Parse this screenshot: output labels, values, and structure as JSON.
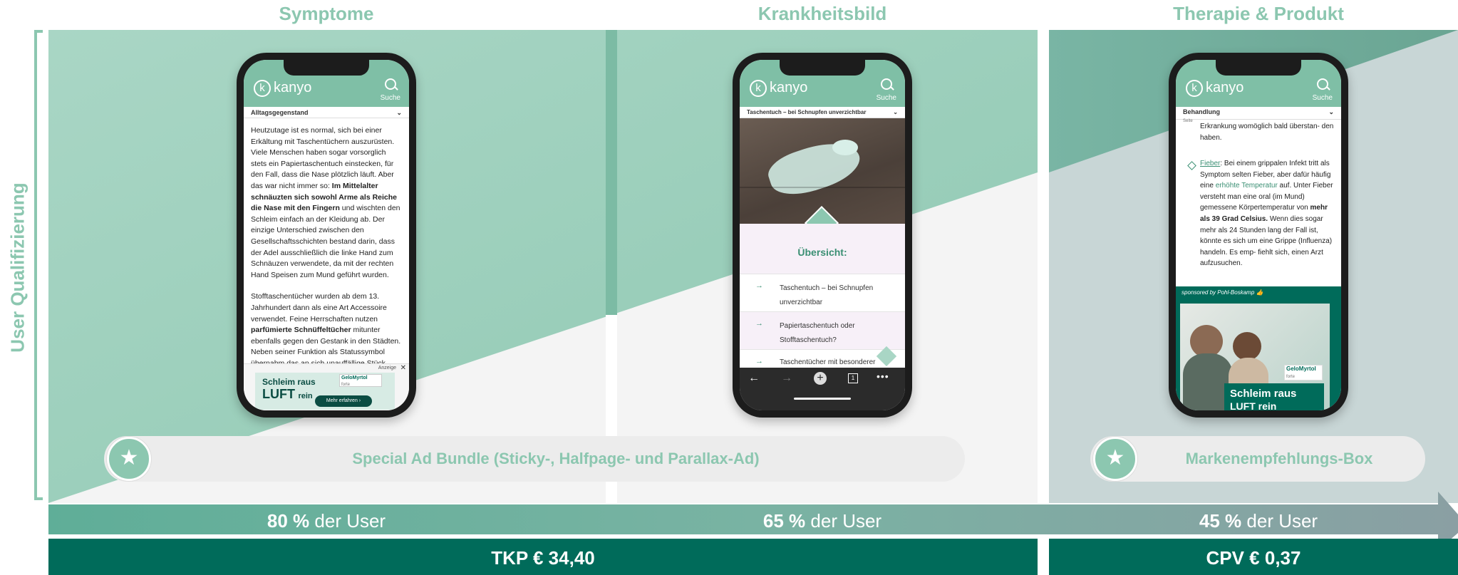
{
  "side_label": "User Qualifizierung",
  "columns": [
    {
      "title": "Symptome",
      "stat_value": "80 %",
      "stat_suffix": " der User"
    },
    {
      "title": "Krankheitsbild",
      "stat_value": "65 %",
      "stat_suffix": " der User"
    },
    {
      "title": "Therapie & Produkt",
      "stat_value": "45 %",
      "stat_suffix": " der User"
    }
  ],
  "bundles": {
    "special_ad": "Special Ad Bundle (Sticky-, Halfpage- und Parallax-Ad)",
    "brand_box": "Markenempfehlungs-Box"
  },
  "prices": {
    "tkp": "TKP € 34,40",
    "cpv": "CPV € 0,37"
  },
  "phone": {
    "logo": "kanyo",
    "logo_mark": "k",
    "search_label": "Suche"
  },
  "phone1": {
    "dropdown": "Alltagsgegenstand",
    "paragraph1_a": "Heutzutage ist es normal, sich bei einer Erkältung mit Taschentüchern auszurüsten. Viele Menschen haben sogar vorsorglich stets ein Papiertaschentuch einstecken, für den Fall, dass die Nase plötzlich läuft. Aber das war nicht immer so: ",
    "paragraph1_bold": "Im Mittelalter schnäuzten sich sowohl Arme als Reiche die Nase mit den Fingern",
    "paragraph1_b": " und wischten den Schleim einfach an der Kleidung ab. Der einzige Unterschied zwischen den Gesellschaftsschichten bestand darin, dass der Adel ausschließlich die linke Hand zum Schnäuzen verwendete, da mit der rechten Hand Speisen zum Mund geführt wurden.",
    "paragraph2_a": "Stofftaschentücher wurden ab dem 13. Jahrhundert dann als eine Art Accessoire verwendet. Feine Herrschaften nutzen ",
    "paragraph2_bold": "parfümierte Schnüffeltücher",
    "paragraph2_b": " mitunter ebenfalls gegen den Gestank in den Städten. Neben seiner Funktion als Statussymbol übernahm das an sich unauffällige Stück",
    "ad_label": "Anzeige",
    "ad_close": "✕",
    "ad_line1": "Schleim raus",
    "ad_line2a": "LUFT",
    "ad_line2b": "rein",
    "ad_brand": "GeloMyrtol",
    "ad_brand_sub": "forte",
    "ad_cta": "Mehr erfahren"
  },
  "phone2": {
    "dropdown": "Taschentuch – bei Schnupfen unverzichtbar",
    "overview_title": "Übersicht:",
    "items": [
      "Taschentuch – bei Schnupfen unverzichtbar",
      "Papiertaschentuch oder Stofftaschentuch?",
      "Taschentücher mit besonderer Duftnote"
    ],
    "browser_tab_count": "1"
  },
  "phone3": {
    "dropdown": "Behandlung",
    "dropdown_sub": "Seite",
    "text_top": "Erkrankung womöglich bald überstan- den haben.",
    "fever_link": "Fieber",
    "fever_a": ": Bei einem grippalen Infekt tritt als Symptom selten Fieber, aber dafür häufig eine ",
    "fever_link2": "erhöhte Temperatur",
    "fever_b": " auf. Unter Fieber versteht man eine oral (im Mund) gemessene Körpertemperatur von ",
    "fever_bold": "mehr als 39 Grad Celsius.",
    "fever_c": " Wenn dies sogar mehr als 24 Stunden lang der Fall ist, könnte es sich um eine Grippe (Influenza) handeln. Es emp- fiehlt sich, einen Arzt aufzusuchen.",
    "sponsor": "sponsored by Pohl-Boskamp",
    "ad_line1": "Schleim raus",
    "ad_line2": "LUFT rein",
    "ad_brand": "GeloMyrtol",
    "ad_brand_sub": "forte"
  },
  "colors": {
    "teal_light": "#a6d3c2",
    "teal_mid": "#8cc7b0",
    "teal_dark": "#006b5a",
    "grey_bg": "#f2f2f2"
  }
}
